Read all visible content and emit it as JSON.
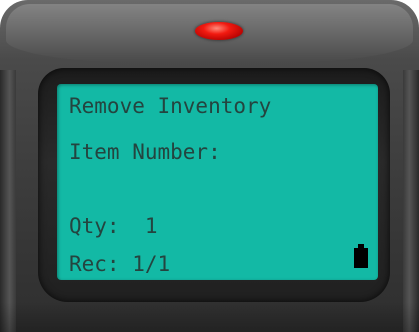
{
  "screen": {
    "title": "Remove Inventory",
    "item_number_label": "Item Number:",
    "qty_line": "Qty:  1",
    "rec_line": "Rec: 1/1"
  },
  "device": {
    "led_color": "#f21a10",
    "screen_color": "#13b9a5",
    "text_color": "#24443f",
    "battery_icon": "battery-icon"
  }
}
